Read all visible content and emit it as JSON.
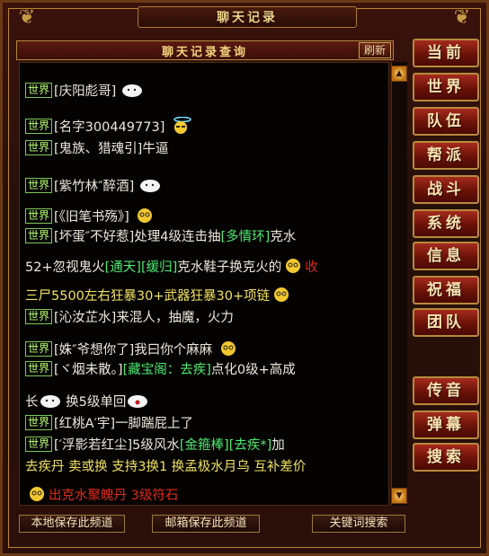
{
  "window": {
    "title": "聊天记录"
  },
  "query": {
    "title": "聊天记录查询",
    "refresh_label": "刷新"
  },
  "side_tabs": [
    "当前",
    "世界",
    "队伍",
    "帮派",
    "战斗",
    "系统",
    "信息",
    "祝福",
    "团队",
    "传音",
    "弹幕",
    "搜索"
  ],
  "bottom": {
    "save_local": "本地保存此频道",
    "save_mail": "邮箱保存此频道",
    "keyword_search": "关键词搜索"
  },
  "channel_tag": "世界",
  "messages": {
    "m1": "[庆阳彪哥]",
    "m2": "[名字300449773]",
    "m3": "[鬼族、猎魂引]牛逼",
    "m4": "[紫竹林″醉酒]",
    "m5": "[《旧笔书殇》]",
    "m6a": "[坏蛋″不好惹]处理4级连击抽",
    "m6b": "[多情环]",
    "m6c": "克水",
    "m6d": "52+忽视鬼火",
    "m6e": "[通天]",
    "m6f": "[缓归]",
    "m6g": "克水鞋子换克火的",
    "m6h": "收",
    "m6i": "三尸5500左右狂暴30+武器狂暴30+项链",
    "m7": "[沁汝芷水]来混人，抽魔，火力",
    "m8": "[姝″爷想你了]我曰你个麻麻",
    "m9a": "[ヾ烟未散。]",
    "m9b": "[藏宝阁：去疾]",
    "m9c": "点化0级+高成",
    "m9d": "长",
    "m9e": "换5级单回",
    "m10": "[红桃A′宇]一脚踹屁上了",
    "m11a": "[′浮影若红尘]5级风水",
    "m11b": "[金箍棒]",
    "m11c": "[去疾*]",
    "m11d": "加",
    "m11e": "去疾丹 卖或换 支持3换1 换孟极水月乌 互补差价",
    "m11f": "出克水聚魄丹 3级符石"
  },
  "colors": {
    "accent": "#b8862e",
    "tag_green": "#b8ff70",
    "item_green": "#4ee870",
    "highlight_yellow": "#f0e060",
    "alert_red": "#e02a1a"
  }
}
